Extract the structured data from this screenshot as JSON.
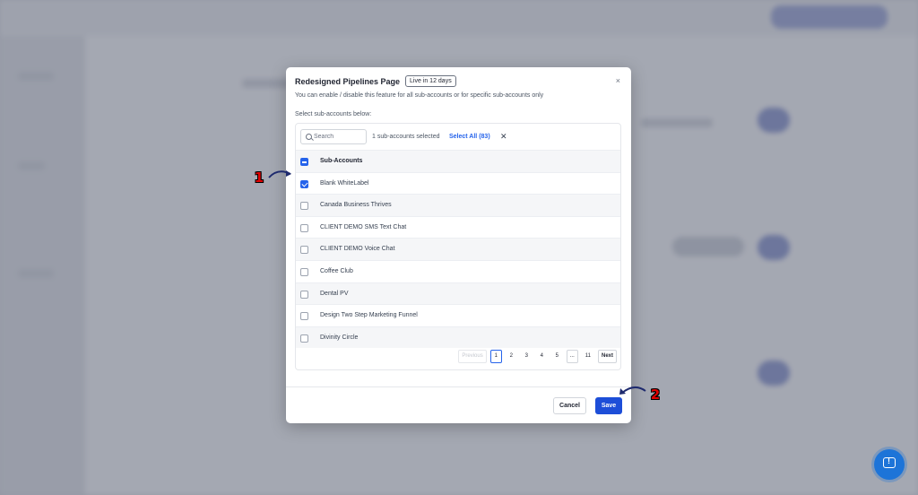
{
  "modal": {
    "title": "Redesigned Pipelines Page",
    "badge": "Live in 12 days",
    "close_label": "×",
    "subtitle": "You can enable / disable this feature for all sub-accounts or for specific sub-accounts only",
    "select_label": "Select sub-accounts below:",
    "search": {
      "placeholder": "Search",
      "value": ""
    },
    "selected_count": "1 sub-accounts selected",
    "select_all": "Select All (83)",
    "clear_label": "✕",
    "header_label": "Sub-Accounts",
    "rows": [
      {
        "label": "Blank WhiteLabel",
        "checked": true
      },
      {
        "label": "Canada Business Thrives",
        "checked": false
      },
      {
        "label": "CLIENT DEMO SMS Text Chat",
        "checked": false
      },
      {
        "label": "CLIENT DEMO Voice Chat",
        "checked": false
      },
      {
        "label": "Coffee Club",
        "checked": false
      },
      {
        "label": "Dental PV",
        "checked": false
      },
      {
        "label": "Design Two Step Marketing Funnel",
        "checked": false
      },
      {
        "label": "Divinity Circle",
        "checked": false
      }
    ],
    "pagination": {
      "previous": "Previous",
      "pages": [
        "1",
        "2",
        "3",
        "4",
        "5",
        "...",
        "11"
      ],
      "current": "1",
      "next": "Next"
    },
    "cancel_label": "Cancel",
    "save_label": "Save"
  },
  "markers": {
    "step1": "1",
    "step2": "2"
  },
  "colors": {
    "accent": "#2563eb",
    "primary_button": "#1d4ed8",
    "marker": "#e00000"
  },
  "icons": {
    "search": "search-icon",
    "help": "feedback-icon"
  }
}
